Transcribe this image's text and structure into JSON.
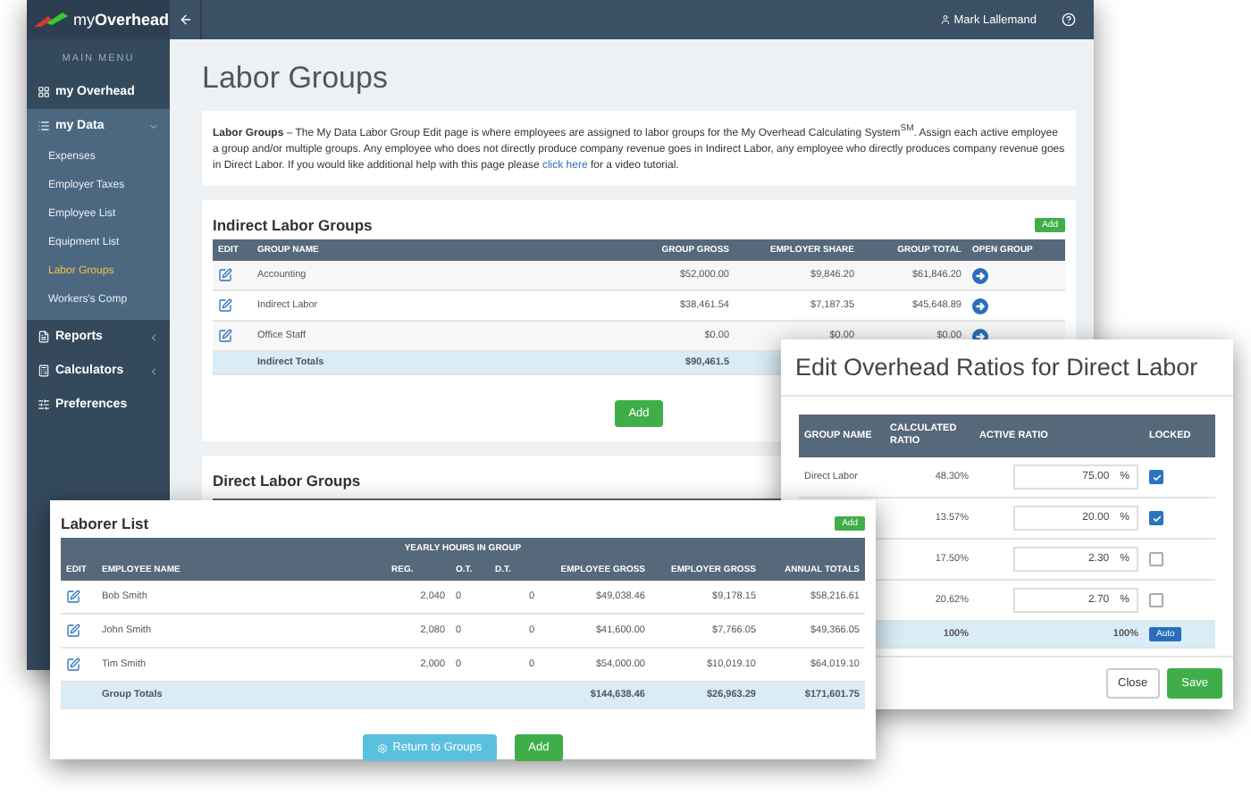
{
  "app": {
    "logo": "my**Overhead**",
    "user": "Mark Lallemand"
  },
  "sidebar": {
    "heading": "MAIN MENU",
    "items": [
      {
        "kind": "grid",
        "label": "my Overhead"
      },
      {
        "kind": "list",
        "label": "my Data",
        "expanded": true,
        "children": [
          {
            "label": "Expenses",
            "selected": false
          },
          {
            "label": "Employer Taxes",
            "selected": false
          },
          {
            "label": "Employee List",
            "selected": false
          },
          {
            "label": "Equipment List",
            "selected": false
          },
          {
            "label": "Labor Groups",
            "selected": true
          },
          {
            "label": "Workers's Comp",
            "selected": false
          }
        ]
      },
      {
        "kind": "reports",
        "label": "Reports",
        "expanded": false
      },
      {
        "kind": "calculator",
        "label": "Calculators",
        "expanded": false
      },
      {
        "kind": "sliders",
        "label": "Preferences"
      }
    ]
  },
  "page": {
    "title": "Labor Groups",
    "intro": {
      "text": "**Labor Groups** – The My Data Labor Group Edit page is where employees are assigned to labor groups for the My Overhead Calculating System$^{SM}$. Assign each active employee a group and/or multiple groups. Any employee who does not directly produce company revenue goes in Indirect Labor, any employee who directly produces company revenue goes in Direct Labor. If you would like additional help with this page please",
      "link": "click here",
      "text_after": "for a video tutorial."
    }
  },
  "indirect": {
    "title": "Indirect Labor Groups",
    "add": "Add",
    "columns": [
      "EDIT",
      "GROUP NAME",
      "GROUP GROSS",
      "EMPLOYER SHARE",
      "GROUP TOTAL",
      "OPEN GROUP"
    ],
    "rows": [
      {
        "name": "Accounting",
        "gross": "$52,000.00",
        "share": "$9,846.20",
        "total": "$61,846.20"
      },
      {
        "name": "Indirect Labor",
        "gross": "$38,461.54",
        "share": "$7,187.35",
        "total": "$45,648.89"
      },
      {
        "name": "Office Staff",
        "gross": "$0.00",
        "share": "$0.00",
        "total": "$0.00"
      }
    ],
    "totals": {
      "label": "Indirect Totals",
      "gross": "$90,461.5"
    },
    "button": "Add"
  },
  "direct": {
    "title": "Direct Labor Groups"
  },
  "ratios_dialog": {
    "title": "Edit Overhead Ratios for Direct Labor",
    "columns": [
      "GROUP NAME",
      "CALCULATED RATIO",
      "ACTIVE RATIO",
      "LOCKED"
    ],
    "rows": [
      {
        "name": "Direct Labor",
        "calculated": "48.30%",
        "active": "75.00",
        "unit": "%",
        "locked": true
      },
      {
        "calculated": "13.57%",
        "active": "20.00",
        "unit": "%",
        "locked": true
      },
      {
        "calculated": "17.50%",
        "active": "2.30",
        "unit": "%",
        "locked": false
      },
      {
        "calculated": "20.62%",
        "active": "2.70",
        "unit": "%",
        "locked": false
      }
    ],
    "totals": {
      "calculated": "100%",
      "active": "100%",
      "button": "Auto"
    },
    "close": "Close",
    "save": "Save"
  },
  "laborer_list": {
    "title": "Laborer List",
    "add": "Add",
    "group_header": "YEARLY HOURS IN GROUP",
    "columns": [
      "EDIT",
      "EMPLOYEE NAME",
      "REG.",
      "O.T.",
      "D.T.",
      "EMPLOYEE GROSS",
      "EMPLOYER GROSS",
      "ANNUAL TOTALS"
    ],
    "rows": [
      {
        "name": "Bob Smith",
        "reg": "2,040",
        "ot": "0",
        "dt": "0",
        "employee_gross": "$49,038.46",
        "employer_gross": "$9,178.15",
        "annual": "$58,216.61"
      },
      {
        "name": "John Smith",
        "reg": "2,080",
        "ot": "0",
        "dt": "0",
        "employee_gross": "$41,600.00",
        "employer_gross": "$7,766.05",
        "annual": "$49,366.05"
      },
      {
        "name": "Tim Smith",
        "reg": "2,000",
        "ot": "0",
        "dt": "0",
        "employee_gross": "$54,000.00",
        "employer_gross": "$10,019.10",
        "annual": "$64,019.10"
      }
    ],
    "totals": {
      "label": "Group Totals",
      "employee_gross": "$144,638.46",
      "employer_gross": "$26,963.29",
      "annual": "$171,601.75"
    },
    "return": "Return to Groups",
    "button": "Add"
  }
}
